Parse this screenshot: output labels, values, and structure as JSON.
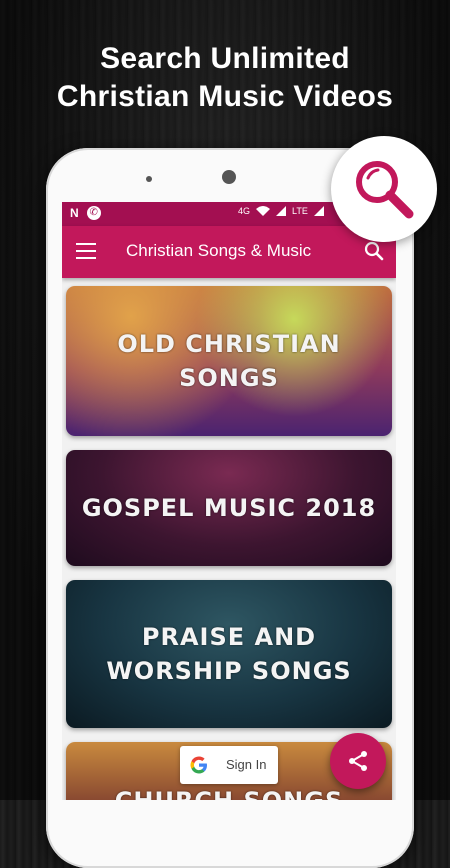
{
  "headline": {
    "line1": "Search Unlimited",
    "line2": "Christian Music Videos"
  },
  "status_bar": {
    "left_icons": [
      "n-notification-icon",
      "phone-call-icon"
    ],
    "lte_label": "LTE",
    "signal_label": "4G"
  },
  "app_bar": {
    "title": "Christian Songs & Music",
    "menu_icon": "hamburger-menu-icon",
    "search_icon": "search-icon"
  },
  "categories": [
    {
      "label": "OLD CHRISTIAN\nSONGS"
    },
    {
      "label": "GOSPEL MUSIC 2018"
    },
    {
      "label": "PRAISE AND\nWORSHIP SONGS"
    },
    {
      "label": "CHURCH SONGS"
    }
  ],
  "sign_in": {
    "label": "Sign In",
    "icon": "google-g-icon"
  },
  "fab": {
    "icon": "share-icon"
  },
  "badge": {
    "icon": "magnifier-icon"
  },
  "colors": {
    "primary": "#c2185b",
    "primary_dark": "#a30f51",
    "background": "#1b1b1b"
  }
}
